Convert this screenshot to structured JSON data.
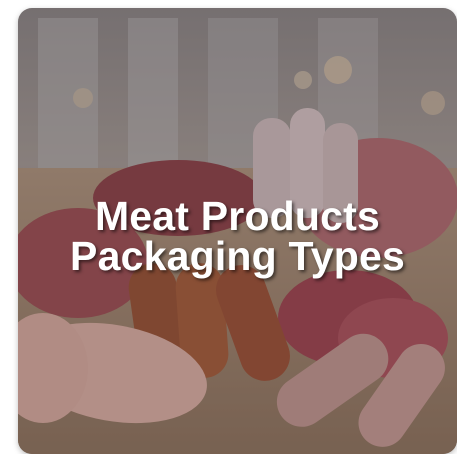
{
  "card": {
    "title_line1": "Meat Products",
    "title_line2": "Packaging Types",
    "image_icon": "meat-assortment-photo",
    "overlay_color": "#463746"
  },
  "colors": {
    "title_text": "#ffffff",
    "background": "#ffffff"
  }
}
